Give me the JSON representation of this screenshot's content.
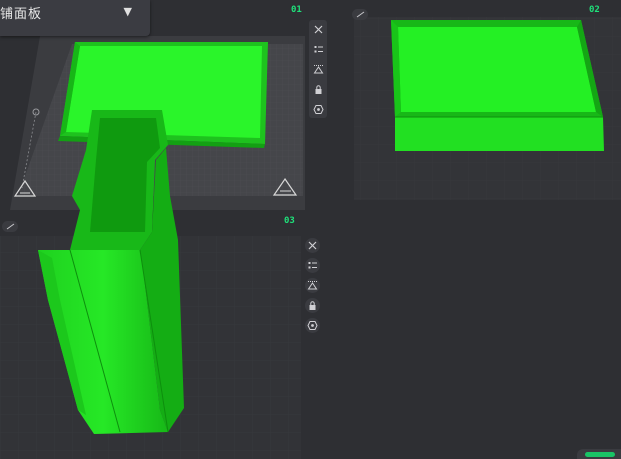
{
  "panel_selector": {
    "label": "平铺面板",
    "arrow_glyph": "▼"
  },
  "plates": [
    {
      "id": "01"
    },
    {
      "id": "02"
    },
    {
      "id": "03"
    }
  ],
  "plate_toolbar_icons": [
    "close-icon",
    "list-icon",
    "auto-orient-icon",
    "lock-icon",
    "settings-icon"
  ],
  "colors": {
    "background": "#2e2f33",
    "plate_surface": "#3a3a3e",
    "plate_label": "#1fe07a",
    "model_green": "#22ff22",
    "model_green_dark": "#0fa50f"
  }
}
